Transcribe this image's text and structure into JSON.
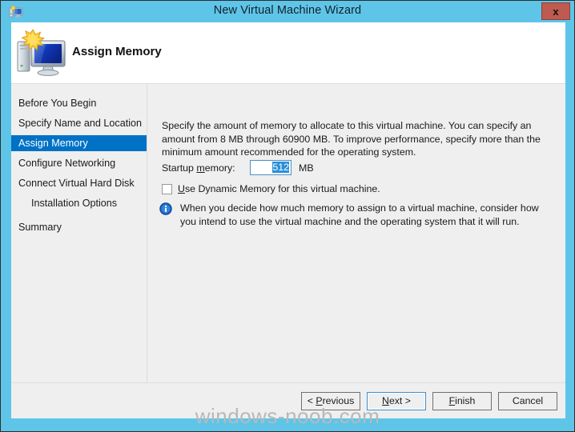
{
  "window": {
    "title": "New Virtual Machine Wizard",
    "app_icon": "virtual-machine-icon",
    "close_label": "x",
    "titlebar_color": "#5ec5e8",
    "close_button_color": "#bf5a51"
  },
  "header": {
    "icon": "virtual-machine-monitor-icon",
    "title": "Assign Memory"
  },
  "sidebar": {
    "selected_color": "#0072c6",
    "items": [
      {
        "label": "Before You Begin",
        "selected": false,
        "indent": false
      },
      {
        "label": "Specify Name and Location",
        "selected": false,
        "indent": false
      },
      {
        "label": "Assign Memory",
        "selected": true,
        "indent": false
      },
      {
        "label": "Configure Networking",
        "selected": false,
        "indent": false
      },
      {
        "label": "Connect Virtual Hard Disk",
        "selected": false,
        "indent": false
      },
      {
        "label": "Installation Options",
        "selected": false,
        "indent": true
      },
      {
        "label": "Summary",
        "selected": false,
        "indent": false
      }
    ]
  },
  "main": {
    "intro": "Specify the amount of memory to allocate to this virtual machine. You can specify an amount from 8 MB through 60900 MB. To improve performance, specify more than the minimum amount recommended for the operating system.",
    "startup_memory": {
      "label_prefix": "Startup ",
      "label_accesskey": "m",
      "label_suffix": "emory:",
      "value": "512",
      "unit": "MB",
      "selected": true
    },
    "dynamic_memory": {
      "checked": false,
      "label_accesskey": "U",
      "label_text": "se Dynamic Memory for this virtual machine."
    },
    "note": {
      "icon": "info-icon",
      "text": "When you decide how much memory to assign to a virtual machine, consider how you intend to use the virtual machine and the operating system that it will run."
    }
  },
  "footer": {
    "buttons": [
      {
        "name": "previous",
        "prefix": "< ",
        "accesskey": "P",
        "suffix": "revious",
        "focused": false
      },
      {
        "name": "next",
        "prefix": "",
        "accesskey": "N",
        "suffix": "ext >",
        "focused": true
      },
      {
        "name": "finish",
        "prefix": "",
        "accesskey": "F",
        "suffix": "inish",
        "focused": false
      },
      {
        "name": "cancel",
        "prefix": "",
        "accesskey": "",
        "suffix": "Cancel",
        "focused": false
      }
    ]
  },
  "watermark": {
    "text": "windows-noob.com"
  }
}
